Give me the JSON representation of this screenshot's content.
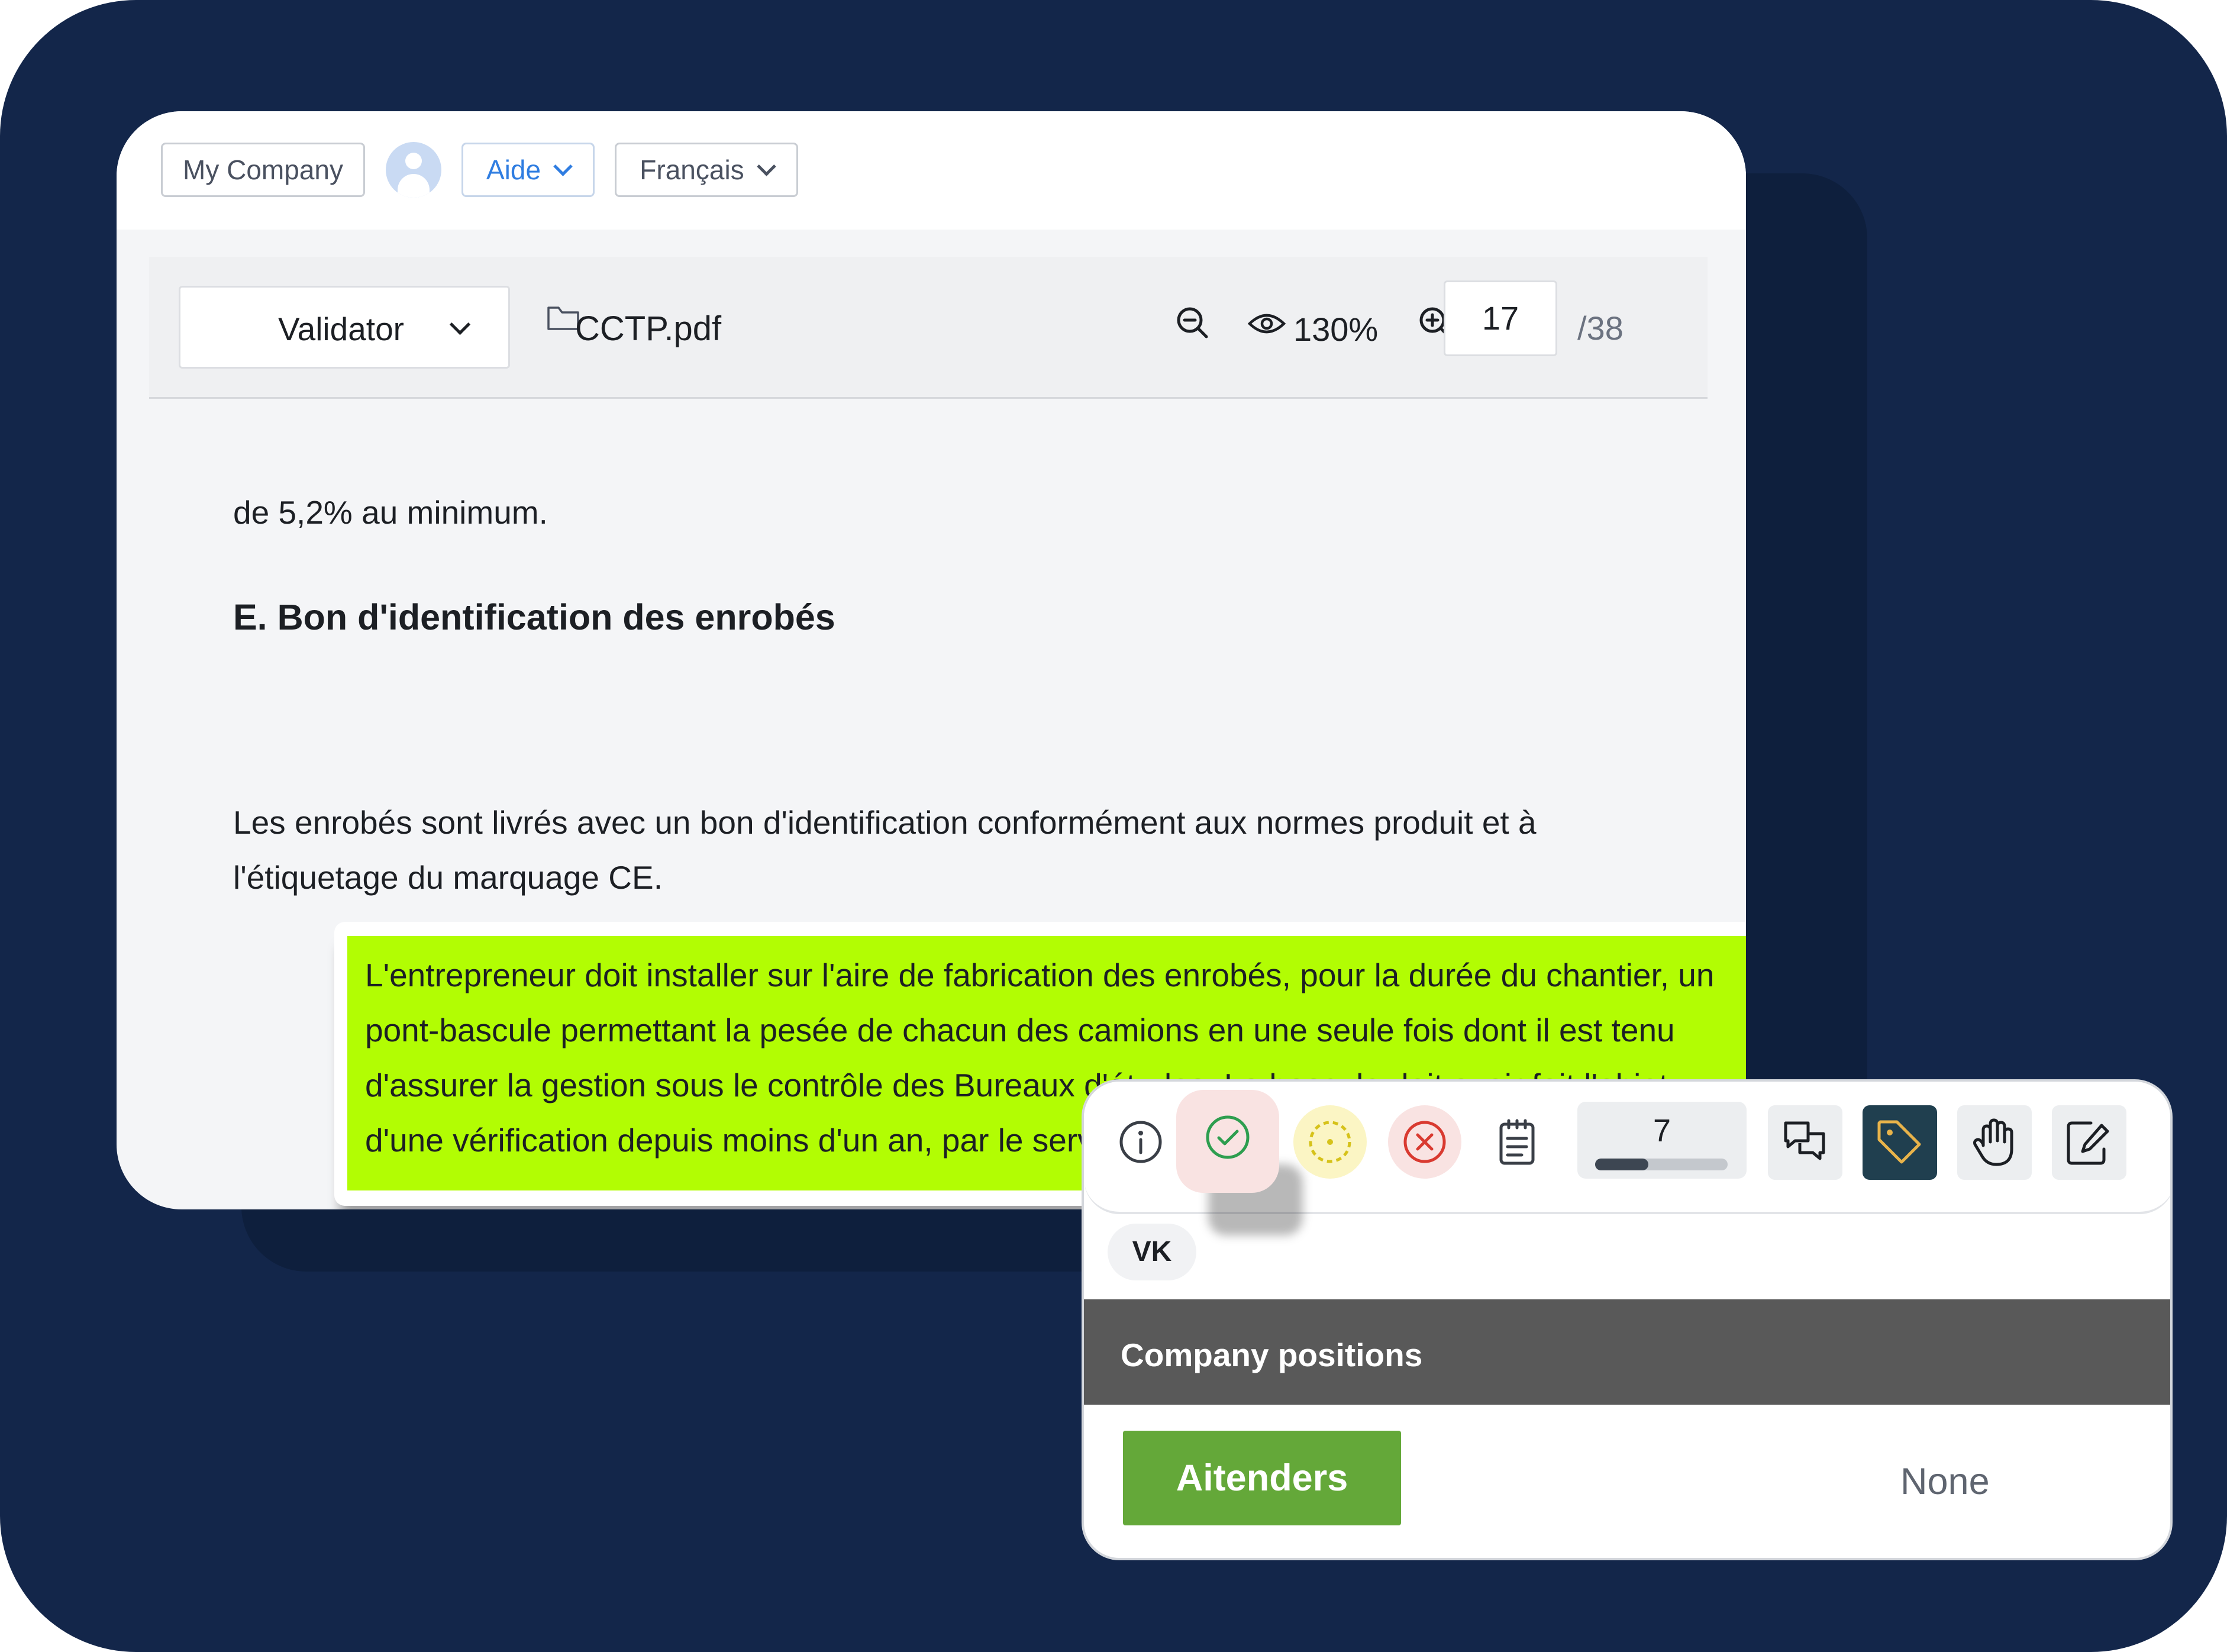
{
  "header": {
    "company": "My Company",
    "help_label": "Aide",
    "language": "Français"
  },
  "toolbar": {
    "mode": "Validator",
    "file_name": "CCTP.pdf",
    "zoom": "130%",
    "page_current": "17",
    "page_total": "/38"
  },
  "document": {
    "line_before": "de 5,2% au minimum.",
    "heading": "E. Bon d'identification des enrobés",
    "paragraph": "Les enrobés sont livrés avec un bon d'identification conformément aux normes produit et à l'étiquetage du marquage CE.",
    "highlighted": "L'entrepreneur doit installer sur l'aire de fabrication des enrobés, pour la durée du chantier, un pont-bascule permettant la pesée de chacun des camions en une seule fois dont il est tenu d'assurer la gestion sous le contrôle des Bureaux d'études. La bascule doit avoir fait l'objet d'une vérification depuis moins d'un an, par le service des poids et mesures.",
    "highlight_color": "#b2fd03"
  },
  "panel": {
    "icons": [
      "info-icon",
      "check-circle-icon",
      "pending-circle-icon",
      "close-circle-icon",
      "clipboard-icon",
      "chat-icon",
      "tag-icon",
      "hand-icon",
      "edit-icon"
    ],
    "counter": "7",
    "counter_progress": 0.4,
    "initials": "VK",
    "section_title": "Company positions",
    "company_name": "Aitenders",
    "position_value": "None",
    "colors": {
      "approve": "#2e9e4f",
      "pending": "#d6c21a",
      "reject": "#d93a30",
      "active_tile": "#203f4f",
      "brand_button": "#64a839",
      "page_background": "#13264a"
    }
  }
}
